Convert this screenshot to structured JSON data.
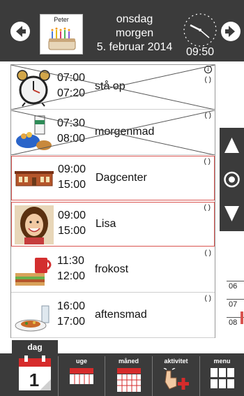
{
  "header": {
    "profile_name": "Peter",
    "weekday": "onsdag",
    "period": "morgen",
    "date": "5. februar 2014",
    "time": "09:50"
  },
  "activities": [
    {
      "start": "07:00",
      "end": "07:20",
      "title": "stå op",
      "icon": "alarm-clock-icon",
      "done": true
    },
    {
      "start": "07:30",
      "end": "08:00",
      "title": "morgenmad",
      "icon": "breakfast-icon",
      "done": true
    },
    {
      "start": "09:00",
      "end": "15:00",
      "title": "Dagcenter",
      "icon": "building-icon",
      "done": false
    },
    {
      "start": "09:00",
      "end": "15:00",
      "title": "Lisa",
      "icon": "person-photo-icon",
      "done": false
    },
    {
      "start": "11:30",
      "end": "12:00",
      "title": "frokost",
      "icon": "lunch-icon",
      "done": false
    },
    {
      "start": "16:00",
      "end": "17:00",
      "title": "aftensmad",
      "icon": "dinner-icon",
      "done": false
    }
  ],
  "timeline": {
    "labels": [
      "06",
      "07",
      "08"
    ]
  },
  "tabs": {
    "day": "dag",
    "week": "uge",
    "month": "måned",
    "activity": "aktivitet",
    "menu": "menu"
  },
  "colors": {
    "header_bg": "#3b3b3b",
    "current_border": "#d9534f",
    "calendar_red": "#d62b2b"
  }
}
